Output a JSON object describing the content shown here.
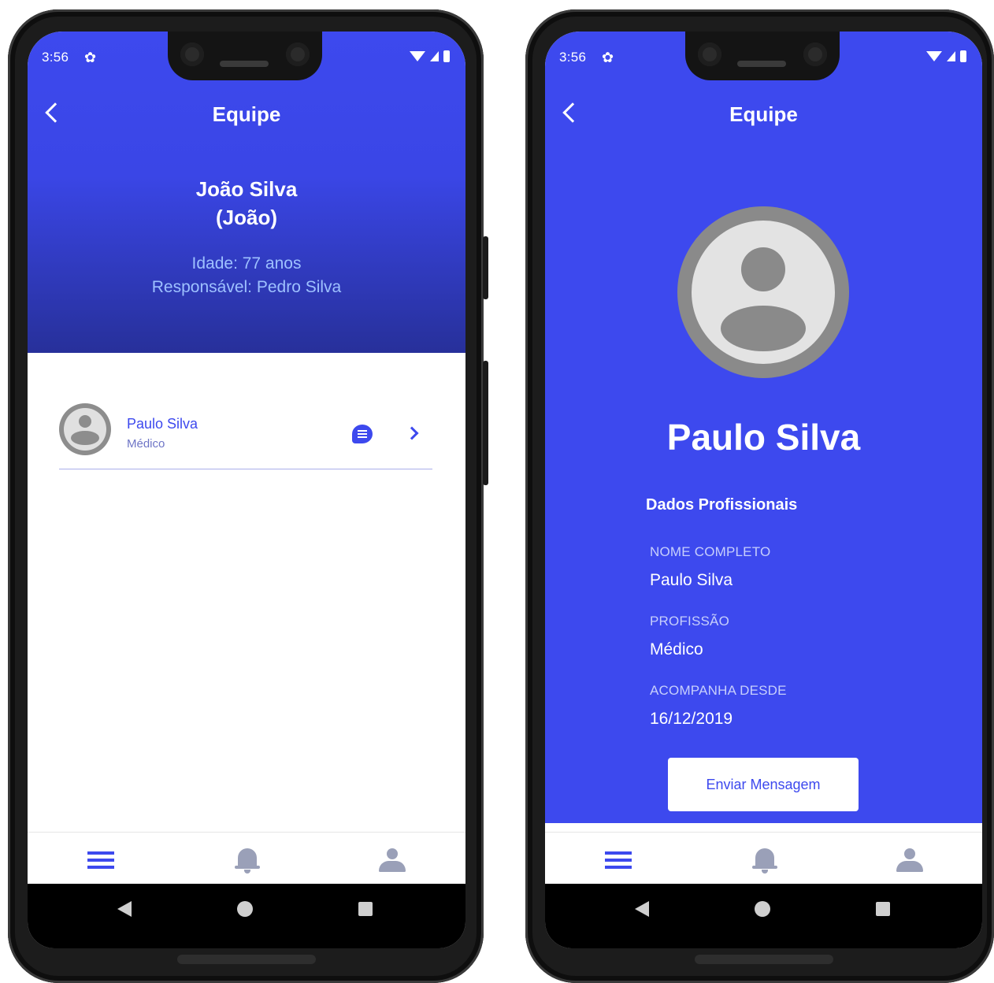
{
  "status_bar": {
    "time": "3:56"
  },
  "left_screen": {
    "header": {
      "title": "Equipe"
    },
    "patient": {
      "name": "João Silva",
      "nickname": "(João)",
      "age": "Idade: 77 anos",
      "responsible": "Responsável: Pedro Silva"
    },
    "team": [
      {
        "name": "Paulo Silva",
        "role": "Médico"
      }
    ]
  },
  "right_screen": {
    "header": {
      "title": "Equipe"
    },
    "profile_name": "Paulo Silva",
    "section_title": "Dados Profissionais",
    "fields": [
      {
        "label": "NOME COMPLETO",
        "value": "Paulo Silva"
      },
      {
        "label": "PROFISSÃO",
        "value": "Médico"
      },
      {
        "label": "ACOMPANHA DESDE",
        "value": "16/12/2019"
      }
    ],
    "send_button": "Enviar Mensagem"
  },
  "bottom_tabs": [
    "menu-icon",
    "bell-icon",
    "user-icon"
  ],
  "colors": {
    "primary": "#3d49ee",
    "light_text": "#9ec1ff",
    "icon_inactive": "#9aa0b8"
  }
}
